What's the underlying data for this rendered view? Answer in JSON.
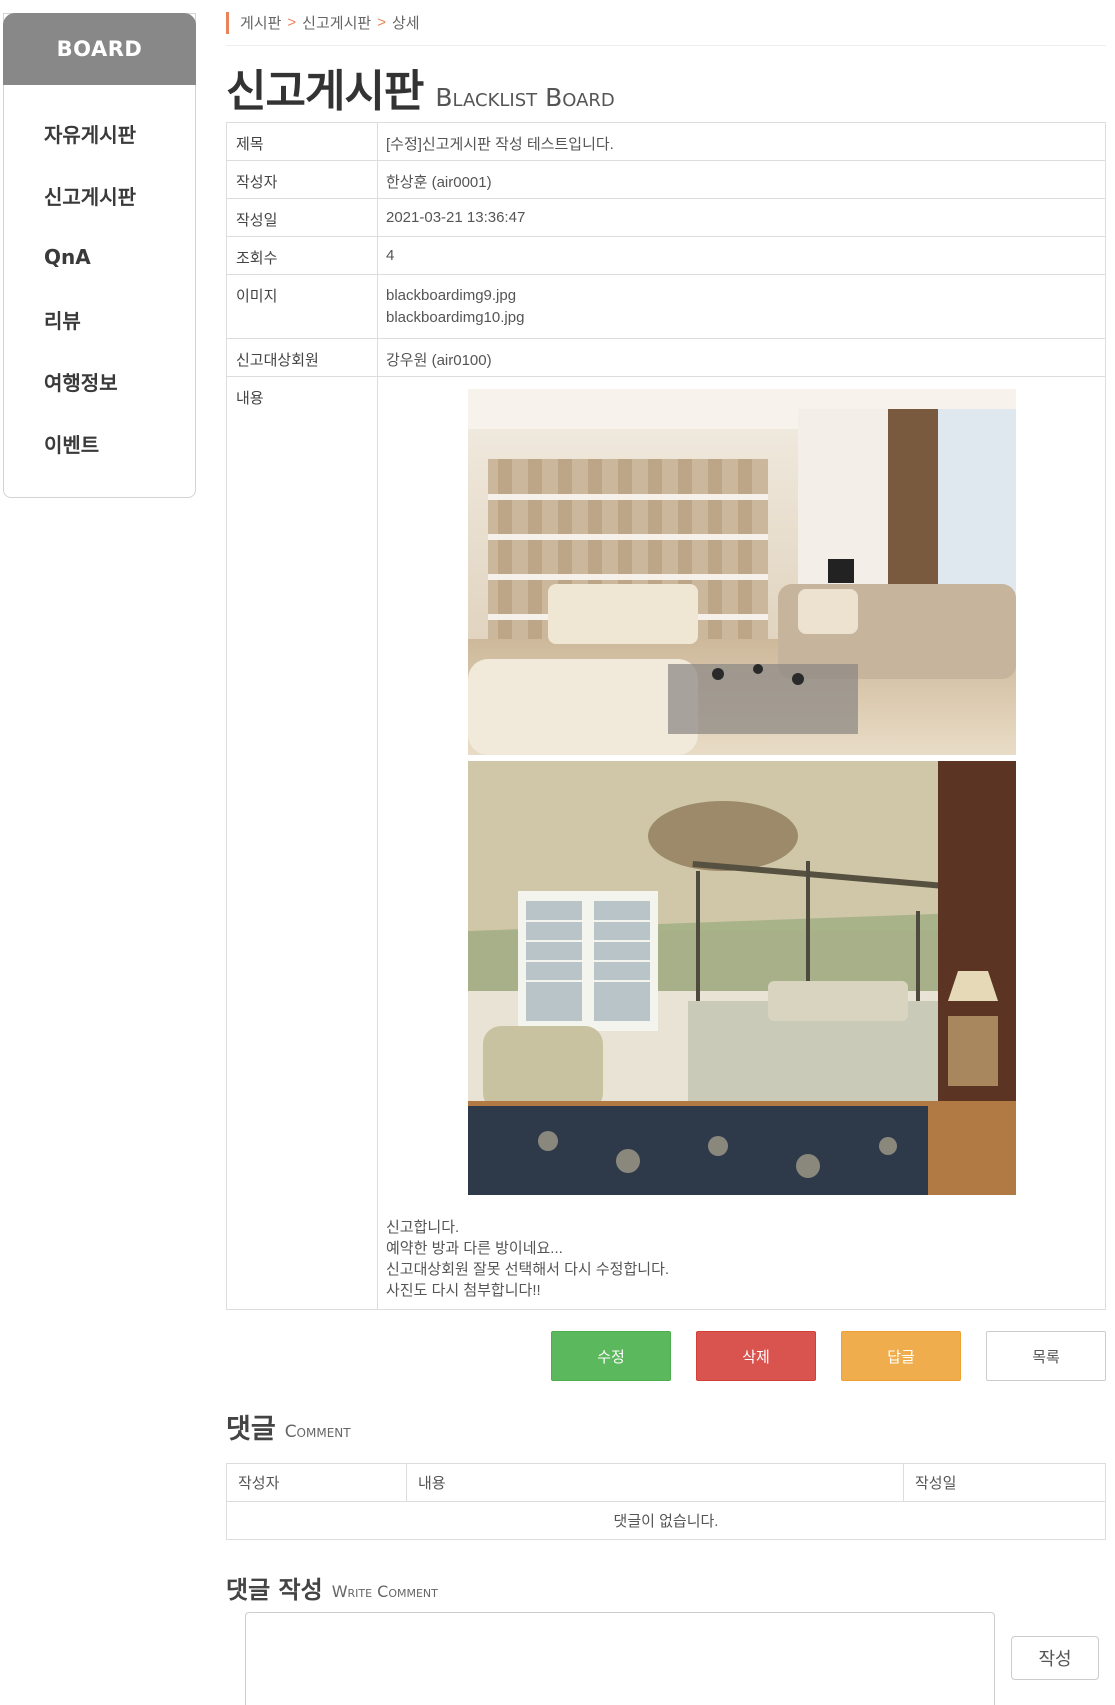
{
  "sidebar": {
    "header": "BOARD",
    "items": [
      {
        "label": "자유게시판"
      },
      {
        "label": "신고게시판"
      },
      {
        "label": "QnA"
      },
      {
        "label": "리뷰"
      },
      {
        "label": "여행정보"
      },
      {
        "label": "이벤트"
      }
    ]
  },
  "breadcrumb": [
    "게시판",
    "신고게시판",
    "상세"
  ],
  "page_title": {
    "ko": "신고게시판",
    "en": "Blacklist Board"
  },
  "post": {
    "title_label": "제목",
    "title": "[수정]신고게시판 작성 테스트입니다.",
    "author_label": "작성자",
    "author": "한상훈 (air0001)",
    "date_label": "작성일",
    "date": "2021-03-21 13:36:47",
    "views_label": "조회수",
    "views": "4",
    "images_label": "이미지",
    "images": [
      "blackboardimg9.jpg",
      "blackboardimg10.jpg"
    ],
    "target_label": "신고대상회원",
    "target": "강우원 (air0100)",
    "content_label": "내용",
    "content_lines": [
      "신고합니다.",
      "예약한 방과 다른 방이네요...",
      "신고대상회원 잘못 선택해서 다시 수정합니다.",
      "사진도 다시 첨부합니다!!"
    ]
  },
  "buttons": {
    "edit": "수정",
    "delete": "삭제",
    "reply": "답글",
    "list": "목록"
  },
  "comments": {
    "title_ko": "댓글",
    "title_en": "Comment",
    "headers": [
      "작성자",
      "내용",
      "작성일"
    ],
    "empty": "댓글이 없습니다."
  },
  "write_comment": {
    "title_ko": "댓글 작성",
    "title_en": "Write Comment",
    "submit": "작성",
    "value": ""
  },
  "colors": {
    "accent": "#e8845a",
    "sidebar_header": "#888888",
    "edit_btn": "#5cb85c",
    "delete_btn": "#d9534f",
    "reply_btn": "#f0ad4e"
  }
}
